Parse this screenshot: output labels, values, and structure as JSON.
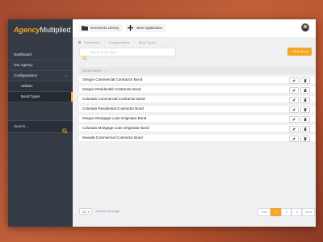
{
  "app": {
    "logo_part1": "Agency",
    "logo_part2": "Multiplied"
  },
  "topbar": {
    "document_library_label": "Document Library",
    "new_application_label": "New Application"
  },
  "sidebar": {
    "items": [
      {
        "label": "Dashboard"
      },
      {
        "label": "Our Agency"
      },
      {
        "label": "Configurations"
      },
      {
        "label": "Utilities"
      },
      {
        "label": "Bond Types"
      }
    ],
    "search_placeholder": "Search..."
  },
  "breadcrumb": {
    "items": [
      "Dashboard",
      "Configurations",
      "Bond Types"
    ]
  },
  "toolbar": {
    "search_placeholder": "Search Bond Type...",
    "new_button_label": "+ New Bond"
  },
  "table": {
    "header": "Bond Name",
    "sort_indicator": "↕",
    "rows": [
      "Oregon Commercial Contractor Bond",
      "Oregon Residential Contractor Bond",
      "Colorado Commercial Contractor Bond",
      "Colorado Residential Contractor Bond",
      "Oregon Mortgage Loan Originator Bond",
      "Colorado Mortgage Loan Originator Bond",
      "Nevada Commercial Contractor Bond"
    ]
  },
  "pagination": {
    "per_page_value": "10",
    "per_page_label": "records per page",
    "prev_label": "Prev",
    "pages": [
      "1",
      "2",
      "3"
    ],
    "next_label": "Next",
    "current_page": 1
  },
  "colors": {
    "accent": "#f5a623",
    "sidebar_bg": "#343b45",
    "content_bg": "#eef0f2"
  },
  "icons": {
    "search": "search-icon",
    "folder": "folder-icon",
    "plus": "plus-icon",
    "edit": "pencil-icon",
    "delete": "trash-icon",
    "home": "home-icon",
    "avatar": "avatar"
  }
}
